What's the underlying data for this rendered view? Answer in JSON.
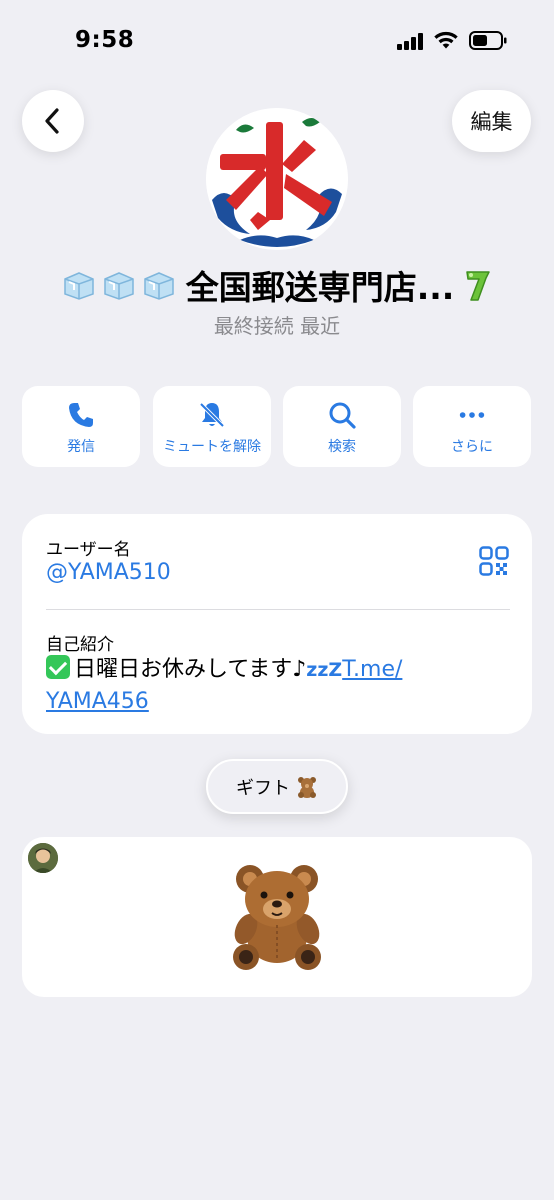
{
  "status_bar": {
    "time": "9:58"
  },
  "header": {
    "edit_label": "編集"
  },
  "profile": {
    "name": "全国郵送専門店...",
    "last_seen": "最終接続 最近"
  },
  "actions": [
    {
      "label": "発信",
      "icon": "phone-icon"
    },
    {
      "label": "ミュートを解除",
      "icon": "bell-slash-icon"
    },
    {
      "label": "検索",
      "icon": "search-icon"
    },
    {
      "label": "さらに",
      "icon": "more-icon"
    }
  ],
  "info": {
    "username_label": "ユーザー名",
    "username": "@YAMA510",
    "bio_label": "自己紹介",
    "bio_text": "日曜日お休みしてます♪",
    "bio_zzz": "zzZ",
    "bio_link_1": "T.me/",
    "bio_link_2": "YAMA456"
  },
  "gift": {
    "label": "ギフト"
  },
  "colors": {
    "accent": "#2a7ae2",
    "background": "#efeff4",
    "card": "#ffffff",
    "secondary_text": "#8a8a8e"
  }
}
